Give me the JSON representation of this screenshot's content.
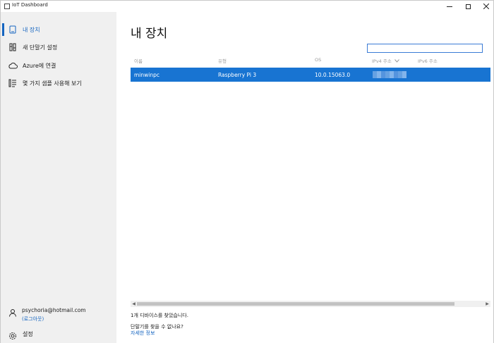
{
  "window": {
    "title": "IoT Dashboard"
  },
  "sidebar": {
    "items": [
      {
        "label": "내 장치",
        "icon": "device-icon",
        "active": true
      },
      {
        "label": "새 단말기 설정",
        "icon": "setup-icon",
        "active": false
      },
      {
        "label": "Azure에 연결",
        "icon": "cloud-icon",
        "active": false
      },
      {
        "label": "몇 가지 샘플 사용해 보기",
        "icon": "samples-icon",
        "active": false
      }
    ],
    "account": {
      "email": "psychoria@hotmail.com",
      "logout": "(로그아웃)"
    },
    "settings_label": "설정"
  },
  "main": {
    "title": "내 장치",
    "search": {
      "value": "",
      "placeholder": ""
    },
    "columns": [
      "이름",
      "유형",
      "OS",
      "IPv4 주소",
      "IPv6 주소"
    ],
    "rows": [
      {
        "name": "minwinpc",
        "type": "Raspberry Pi 3",
        "os": "10.0.15063.0",
        "ipv4": "",
        "ipv6": "",
        "selected": true
      }
    ],
    "found_text": "1개 디바이스를 찾았습니다.",
    "cant_find_text": "단말기를 찾을 수 없나요?",
    "more_info_link": "자세한 정보"
  },
  "colors": {
    "accent": "#1565c0",
    "selection": "#1874d2",
    "sidebar_bg": "#f0f0f0"
  }
}
